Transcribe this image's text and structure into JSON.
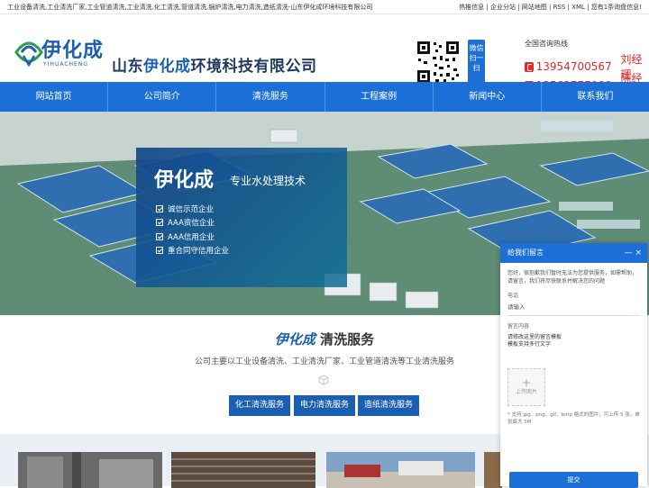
{
  "topbar": {
    "keywords": "工业设备清洗,工业清洗厂家,工业管道清洗,工业清洗,化工清洗,管道清洗,锅炉清洗,电力清洗,造纸清洗-山东伊化成环境科技有限公司",
    "links": "热推信息 | 企业分站 | 网站地图 | RSS | XML | 您有",
    "msg_count": "1",
    "msg_suffix": "条询盘信息!"
  },
  "header": {
    "logo_text": "伊化成",
    "logo_sub": "YIHUACHENG",
    "company_prefix": "山东",
    "company_brand": "伊化成",
    "company_suffix": "环境科技有限公司",
    "wechat_label": "微信扫一扫",
    "hotline_label": "全国咨询热线",
    "phones": [
      {
        "number": "13954700567",
        "name": "刘经理"
      },
      {
        "number": "13563777088",
        "name": "陈经理"
      }
    ]
  },
  "nav": [
    "网站首页",
    "公司简介",
    "清洗服务",
    "工程案例",
    "新闻中心",
    "联系我们"
  ],
  "banner": {
    "brand": "伊化成",
    "tagline": "专业水处理技术",
    "items": [
      "诚信示范企业",
      "AAA资信企业",
      "AAA信用企业",
      "重合同守信用企业"
    ]
  },
  "services": {
    "title_brand": "伊化成",
    "title_rest": " 清洗服务",
    "desc": "公司主要以工业设备清洗、工业清洗厂家、工业管道清洗等工业清洗服务",
    "buttons": [
      "化工清洗服务",
      "电力清洗服务",
      "造纸清洗服务"
    ]
  },
  "chat": {
    "title": "给我们留言",
    "intro": "您好，很抱歉我们暂时无法为您提供服务，如需帮助，请留言，我们将尽快联系并解决您的问题",
    "phone_label": "电话",
    "phone_placeholder": "请输入",
    "content_label": "留言内容",
    "content_value": "请修改这里的留言模板\n模板支持多行文字",
    "upload_label": "上传图片",
    "note": "* 支持 jpg、png、gif、bmp 格式的图片，可上传 5 张，单张最大 5M",
    "submit": "提交"
  }
}
